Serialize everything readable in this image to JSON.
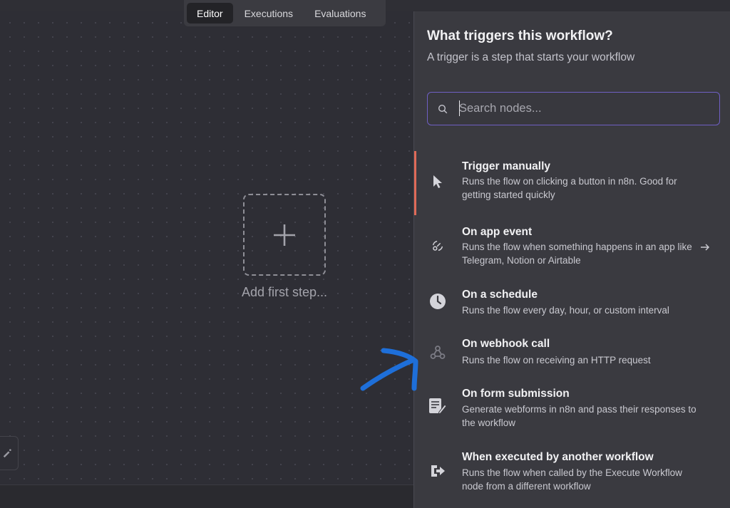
{
  "tabs": [
    {
      "label": "Editor",
      "active": true
    },
    {
      "label": "Executions",
      "active": false
    },
    {
      "label": "Evaluations",
      "active": false
    }
  ],
  "canvas": {
    "add_step_label": "Add first step..."
  },
  "panel": {
    "title": "What triggers this workflow?",
    "subtitle": "A trigger is a step that starts your workflow",
    "search": {
      "placeholder": "Search nodes...",
      "value": ""
    },
    "items": [
      {
        "name": "Trigger manually",
        "description": "Runs the flow on clicking a button in n8n. Good for getting started quickly",
        "icon": "cursor-icon"
      },
      {
        "name": "On app event",
        "description": "Runs the flow when something happens in an app like Telegram, Notion or Airtable",
        "icon": "app-event-icon"
      },
      {
        "name": "On a schedule",
        "description": "Runs the flow every day, hour, or custom interval",
        "icon": "clock-icon"
      },
      {
        "name": "On webhook call",
        "description": "Runs the flow on receiving an HTTP request",
        "icon": "webhook-icon"
      },
      {
        "name": "On form submission",
        "description": "Generate webforms in n8n and pass their responses to the workflow",
        "icon": "form-icon"
      },
      {
        "name": "When executed by another workflow",
        "description": "Runs the flow when called by the Execute Workflow node from a different workflow",
        "icon": "sign-in-icon"
      }
    ]
  },
  "colors": {
    "accent": "#e06a58",
    "search_border": "#6f5fc4",
    "annotation": "#1e6fd9"
  }
}
